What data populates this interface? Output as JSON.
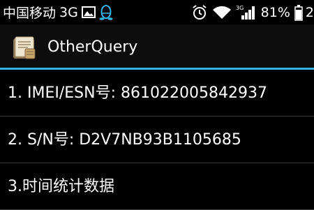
{
  "status_bar": {
    "carrier": "中国移动",
    "network_type": "3G",
    "mobile_data_label": "3G",
    "battery_percent": "81%",
    "clock": "2",
    "icons": [
      "image-notification-icon",
      "qq-penguin-icon",
      "alarm-clock-icon",
      "wifi-icon",
      "signal-strength-icon",
      "battery-icon"
    ],
    "accent_color": "#33b5e5"
  },
  "action_bar": {
    "title": "OtherQuery",
    "icon": "app-notepad-icon"
  },
  "list": {
    "items": [
      {
        "label": "1. IMEI/ESN号: 861022005842937"
      },
      {
        "label": "2. S/N号: D2V7NB93B1105685"
      },
      {
        "label": "3.时间统计数据"
      }
    ]
  }
}
